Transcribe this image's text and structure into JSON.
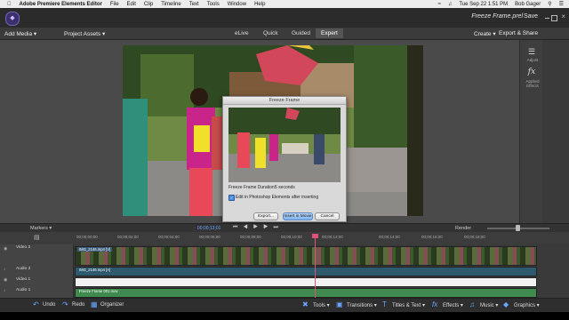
{
  "menubar": {
    "app": "Adobe Premiere Elements Editor",
    "items": [
      "File",
      "Edit",
      "Clip",
      "Timeline",
      "Text",
      "Tools",
      "Window",
      "Help"
    ],
    "clock": "Tue Sep 22  1:51 PM",
    "user": "Bob Gager"
  },
  "titlebar": {
    "document": "Freeze Frame.prel",
    "save": "Save"
  },
  "toolbar": {
    "add_media": "Add Media ▾",
    "project_assets": "Project Assets ▾",
    "modes": [
      "eLive",
      "Quick",
      "Guided",
      "Expert"
    ],
    "create": "Create ▾",
    "export_share": "Export & Share"
  },
  "right_panel": {
    "adjust": "Adjust",
    "fx": "fx",
    "applied_effects": "Applied Effects"
  },
  "dialog": {
    "title": "Freeze Frame",
    "duration_label": "Freeze Frame Duration:",
    "duration_value": "5 seconds",
    "edit_checkbox": "Edit in Photoshop Elements after inserting",
    "export": "Export...",
    "insert": "Insert in Movie",
    "cancel": "Cancel"
  },
  "timeline": {
    "markers": "Markers ▾",
    "render": "Render",
    "current_tc": "00;00;13;01",
    "ruler": [
      "00;00;00;00",
      "00;00;02;00",
      "00;00;04;00",
      "00;00;06;00",
      "00;00;08;00",
      "00;00;10;00",
      "00;00;12;00",
      "00;00;14;00",
      "00;00;16;00",
      "00;00;18;00"
    ],
    "tracks": [
      "Video 2",
      "Audio 2",
      "Video 1",
      "Audio 1"
    ],
    "video_clip": "IMG_2146.mp4 [V]",
    "audio_clip": "IMG_2146.mp4 [A]",
    "v1_clip": "Freeze Frame 001.mov"
  },
  "bottombar": {
    "undo": "Undo",
    "redo": "Redo",
    "organizer": "Organizer",
    "tools": "Tools ▾",
    "transitions": "Transitions ▾",
    "titles": "Titles & Text ▾",
    "effects": "Effects ▾",
    "music": "Music ▾",
    "graphics": "Graphics ▾"
  },
  "colors": {
    "accent": "#6aa6ff",
    "playhead": "#e0507a",
    "green_track": "#3f8a4e"
  }
}
